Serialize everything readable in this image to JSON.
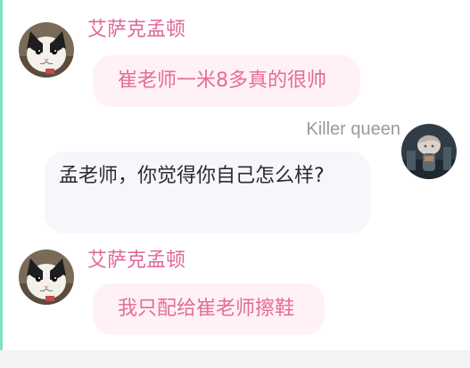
{
  "chat": {
    "messages": [
      {
        "sender": "艾萨克孟顿",
        "text": "崔老师一米8多真的很帅",
        "avatar_icon": "cat-avatar-icon",
        "side": "left"
      },
      {
        "sender": "Killer queen",
        "text": "孟老师，你觉得你自己怎么样?",
        "avatar_icon": "character-avatar-icon",
        "side": "right"
      },
      {
        "sender": "艾萨克孟顿",
        "text": "我只配给崔老师擦鞋",
        "avatar_icon": "cat-avatar-icon",
        "side": "left"
      }
    ]
  },
  "colors": {
    "name_pink": "#e0679a",
    "bubble_pink_bg": "#fff1f5",
    "bubble_pink_text": "#e46c9b",
    "bubble_white_bg": "#f7f6fb",
    "bubble_white_text": "#2b2b2b",
    "name_grey": "#9a9a9a",
    "accent_left_edge": "#7fe2c2"
  }
}
